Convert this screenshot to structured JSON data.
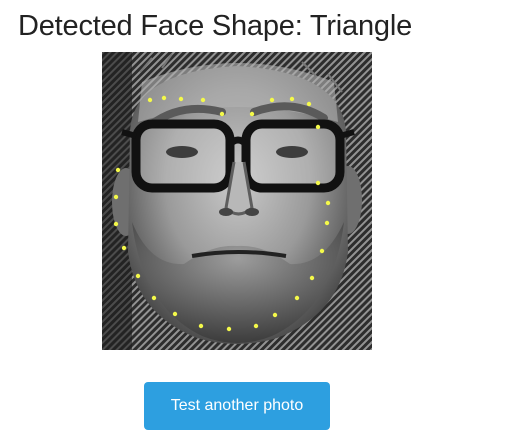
{
  "header": {
    "title": "Detected Face Shape: Triangle"
  },
  "photo": {
    "description_icon": "face-photo",
    "landmark_color": "#f4f94a",
    "landmark_count": 27
  },
  "actions": {
    "retry_label": "Test another photo"
  },
  "colors": {
    "title_text": "#222222",
    "button_bg": "#2d9fe0",
    "button_text": "#ffffff"
  }
}
